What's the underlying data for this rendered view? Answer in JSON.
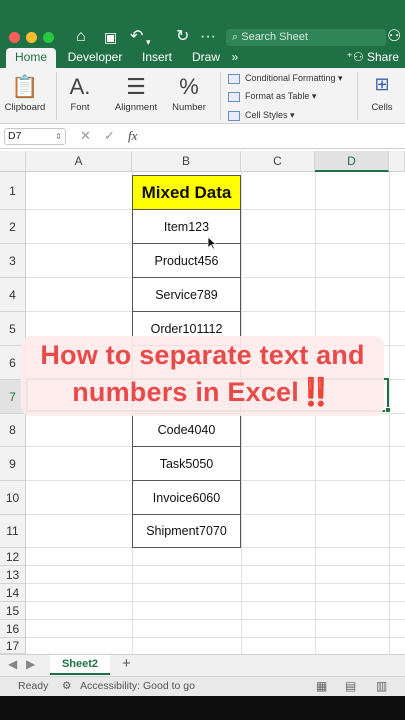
{
  "titlebar": {
    "search_placeholder": "Search Sheet",
    "icons": [
      "home-icon",
      "save-icon",
      "undo-icon",
      "redo-icon",
      "more-icon",
      "search-icon",
      "person-icon"
    ]
  },
  "tabs": [
    "Home",
    "Developer",
    "Insert",
    "Draw"
  ],
  "tabs_more": "»",
  "share_label": "Share",
  "ribbon": {
    "clipboard": "Clipboard",
    "font": "Font",
    "alignment": "Alignment",
    "number": "Number",
    "conditional_formatting": "Conditional Formatting",
    "format_as_table": "Format as Table",
    "cell_styles": "Cell Styles",
    "cells": "Cells"
  },
  "formula_bar": {
    "name_box": "D7",
    "fx": "fx",
    "cancel_glyph": "✕",
    "enter_glyph": "✓"
  },
  "columns": [
    "A",
    "B",
    "C",
    "D"
  ],
  "rows": [
    "1",
    "2",
    "3",
    "4",
    "5",
    "6",
    "7",
    "8",
    "9",
    "10",
    "11",
    "12",
    "13",
    "14",
    "15",
    "16",
    "17"
  ],
  "table": {
    "header": "Mixed Data",
    "items": [
      "Item123",
      "Product456",
      "Service789",
      "Order101112",
      "",
      "",
      "Code4040",
      "Task5050",
      "Invoice6060",
      "Shipment7070"
    ]
  },
  "overlay": {
    "line1": "How to separate text and",
    "line2": "numbers in Excel‼️"
  },
  "sheet_tab": "Sheet2",
  "add_sheet": "+",
  "status": {
    "ready": "Ready",
    "accessibility": "Accessibility: Good to go"
  },
  "colors": {
    "excel_green": "#1f7145",
    "header_fill": "#ffff00",
    "overlay_text": "#e84a4a"
  }
}
